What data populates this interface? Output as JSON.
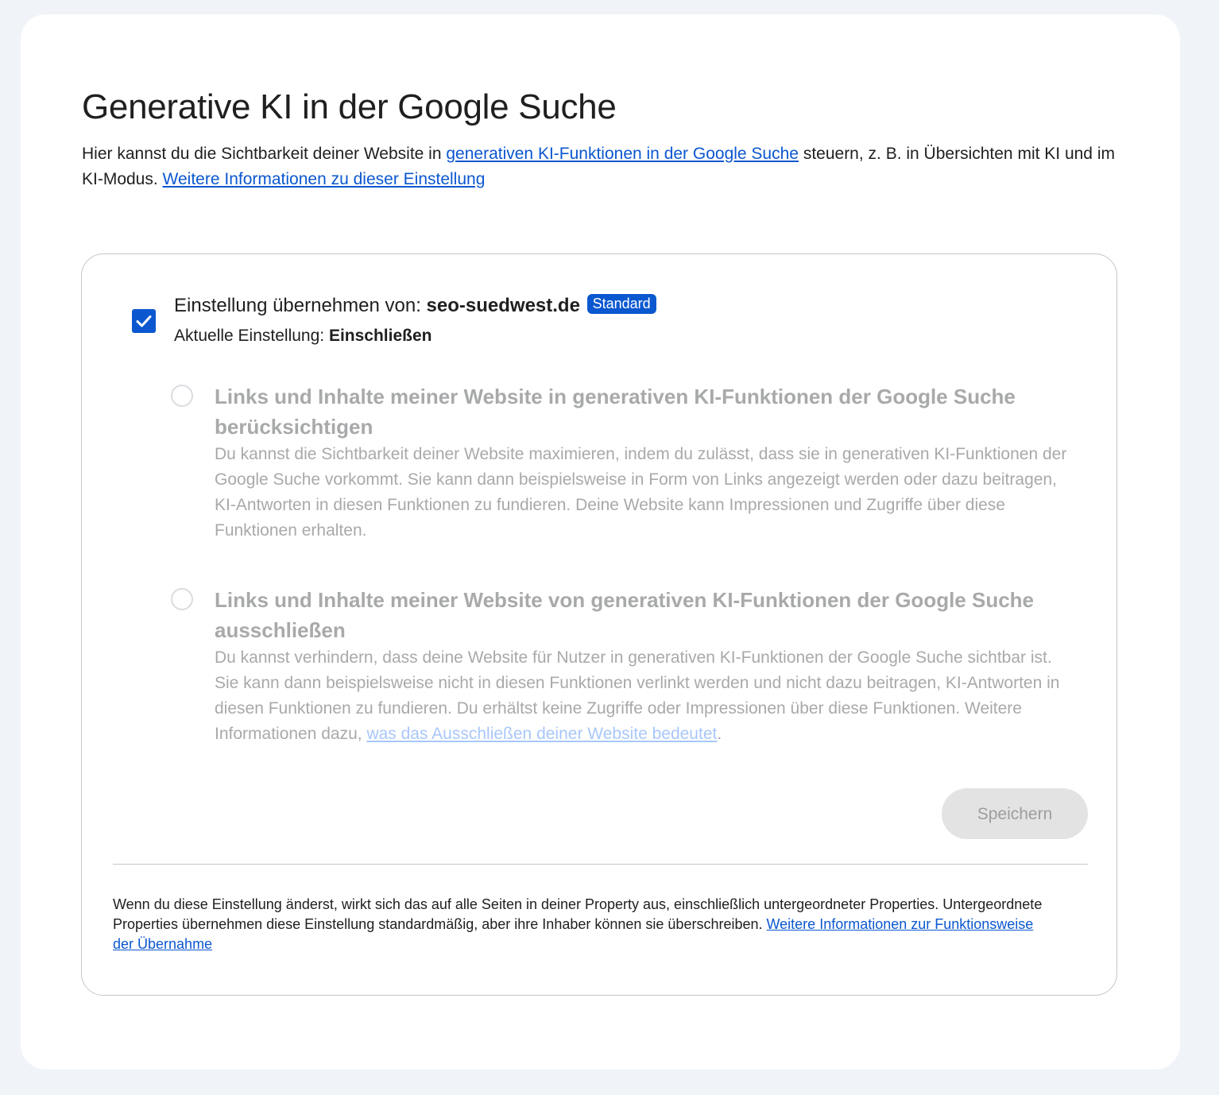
{
  "page": {
    "title": "Generative KI in der Google Suche",
    "intro": {
      "text_1": "Hier kannst du die Sichtbarkeit deiner Website in ",
      "link_1": "generativen KI-Funktionen in der Google Suche",
      "text_2": " steuern, z. B. in Übersichten mit KI und im KI-Modus. ",
      "link_2": "Weitere Informationen zu dieser Einstellung"
    }
  },
  "settings": {
    "inherit_checked": true,
    "inherit_label": "Einstellung übernehmen von: ",
    "inherit_site": "seo-suedwest.de",
    "badge": "Standard",
    "current_label": "Aktuelle Einstellung: ",
    "current_value": "Einschließen",
    "options": [
      {
        "title": "Links und Inhalte meiner Website in generativen KI-Funktionen der Google Suche berücksichtigen",
        "description": "Du kannst die Sichtbarkeit deiner Website maximieren, indem du zulässt, dass sie in generativen KI-Funktionen der Google Suche vorkommt. Sie kann dann beispielsweise in Form von Links angezeigt werden oder dazu beitragen, KI-Antworten in diesen Funktionen zu fundieren. Deine Website kann Impressionen und Zugriffe über diese Funktionen erhalten."
      },
      {
        "title": "Links und Inhalte meiner Website von generativen KI-Funktionen der Google Suche ausschließen",
        "description": "Du kannst verhindern, dass deine Website für Nutzer in generativen KI-Funktionen der Google Suche sichtbar ist. Sie kann dann beispielsweise nicht in diesen Funktionen verlinkt werden und nicht dazu beitragen, KI-Antworten in diesen Funktionen zu fundieren. Du erhältst keine Zugriffe oder Impressionen über diese Funktionen. Weitere Informationen dazu, ",
        "link": "was das Ausschließen deiner Website bedeutet",
        "description_end": "."
      }
    ],
    "save_label": "Speichern",
    "footer": {
      "text": "Wenn du diese Einstellung änderst, wirkt sich das auf alle Seiten in deiner Property aus, einschließlich untergeordneter Properties. Untergeordnete Properties übernehmen diese Einstellung standardmäßig, aber ihre Inhaber können sie überschreiben. ",
      "link": "Weitere Informationen zur Funktionsweise der Übernahme"
    }
  },
  "colors": {
    "accent": "#0b57d0",
    "background": "#f0f4f9",
    "disabled_text": "#a8a9aa"
  }
}
